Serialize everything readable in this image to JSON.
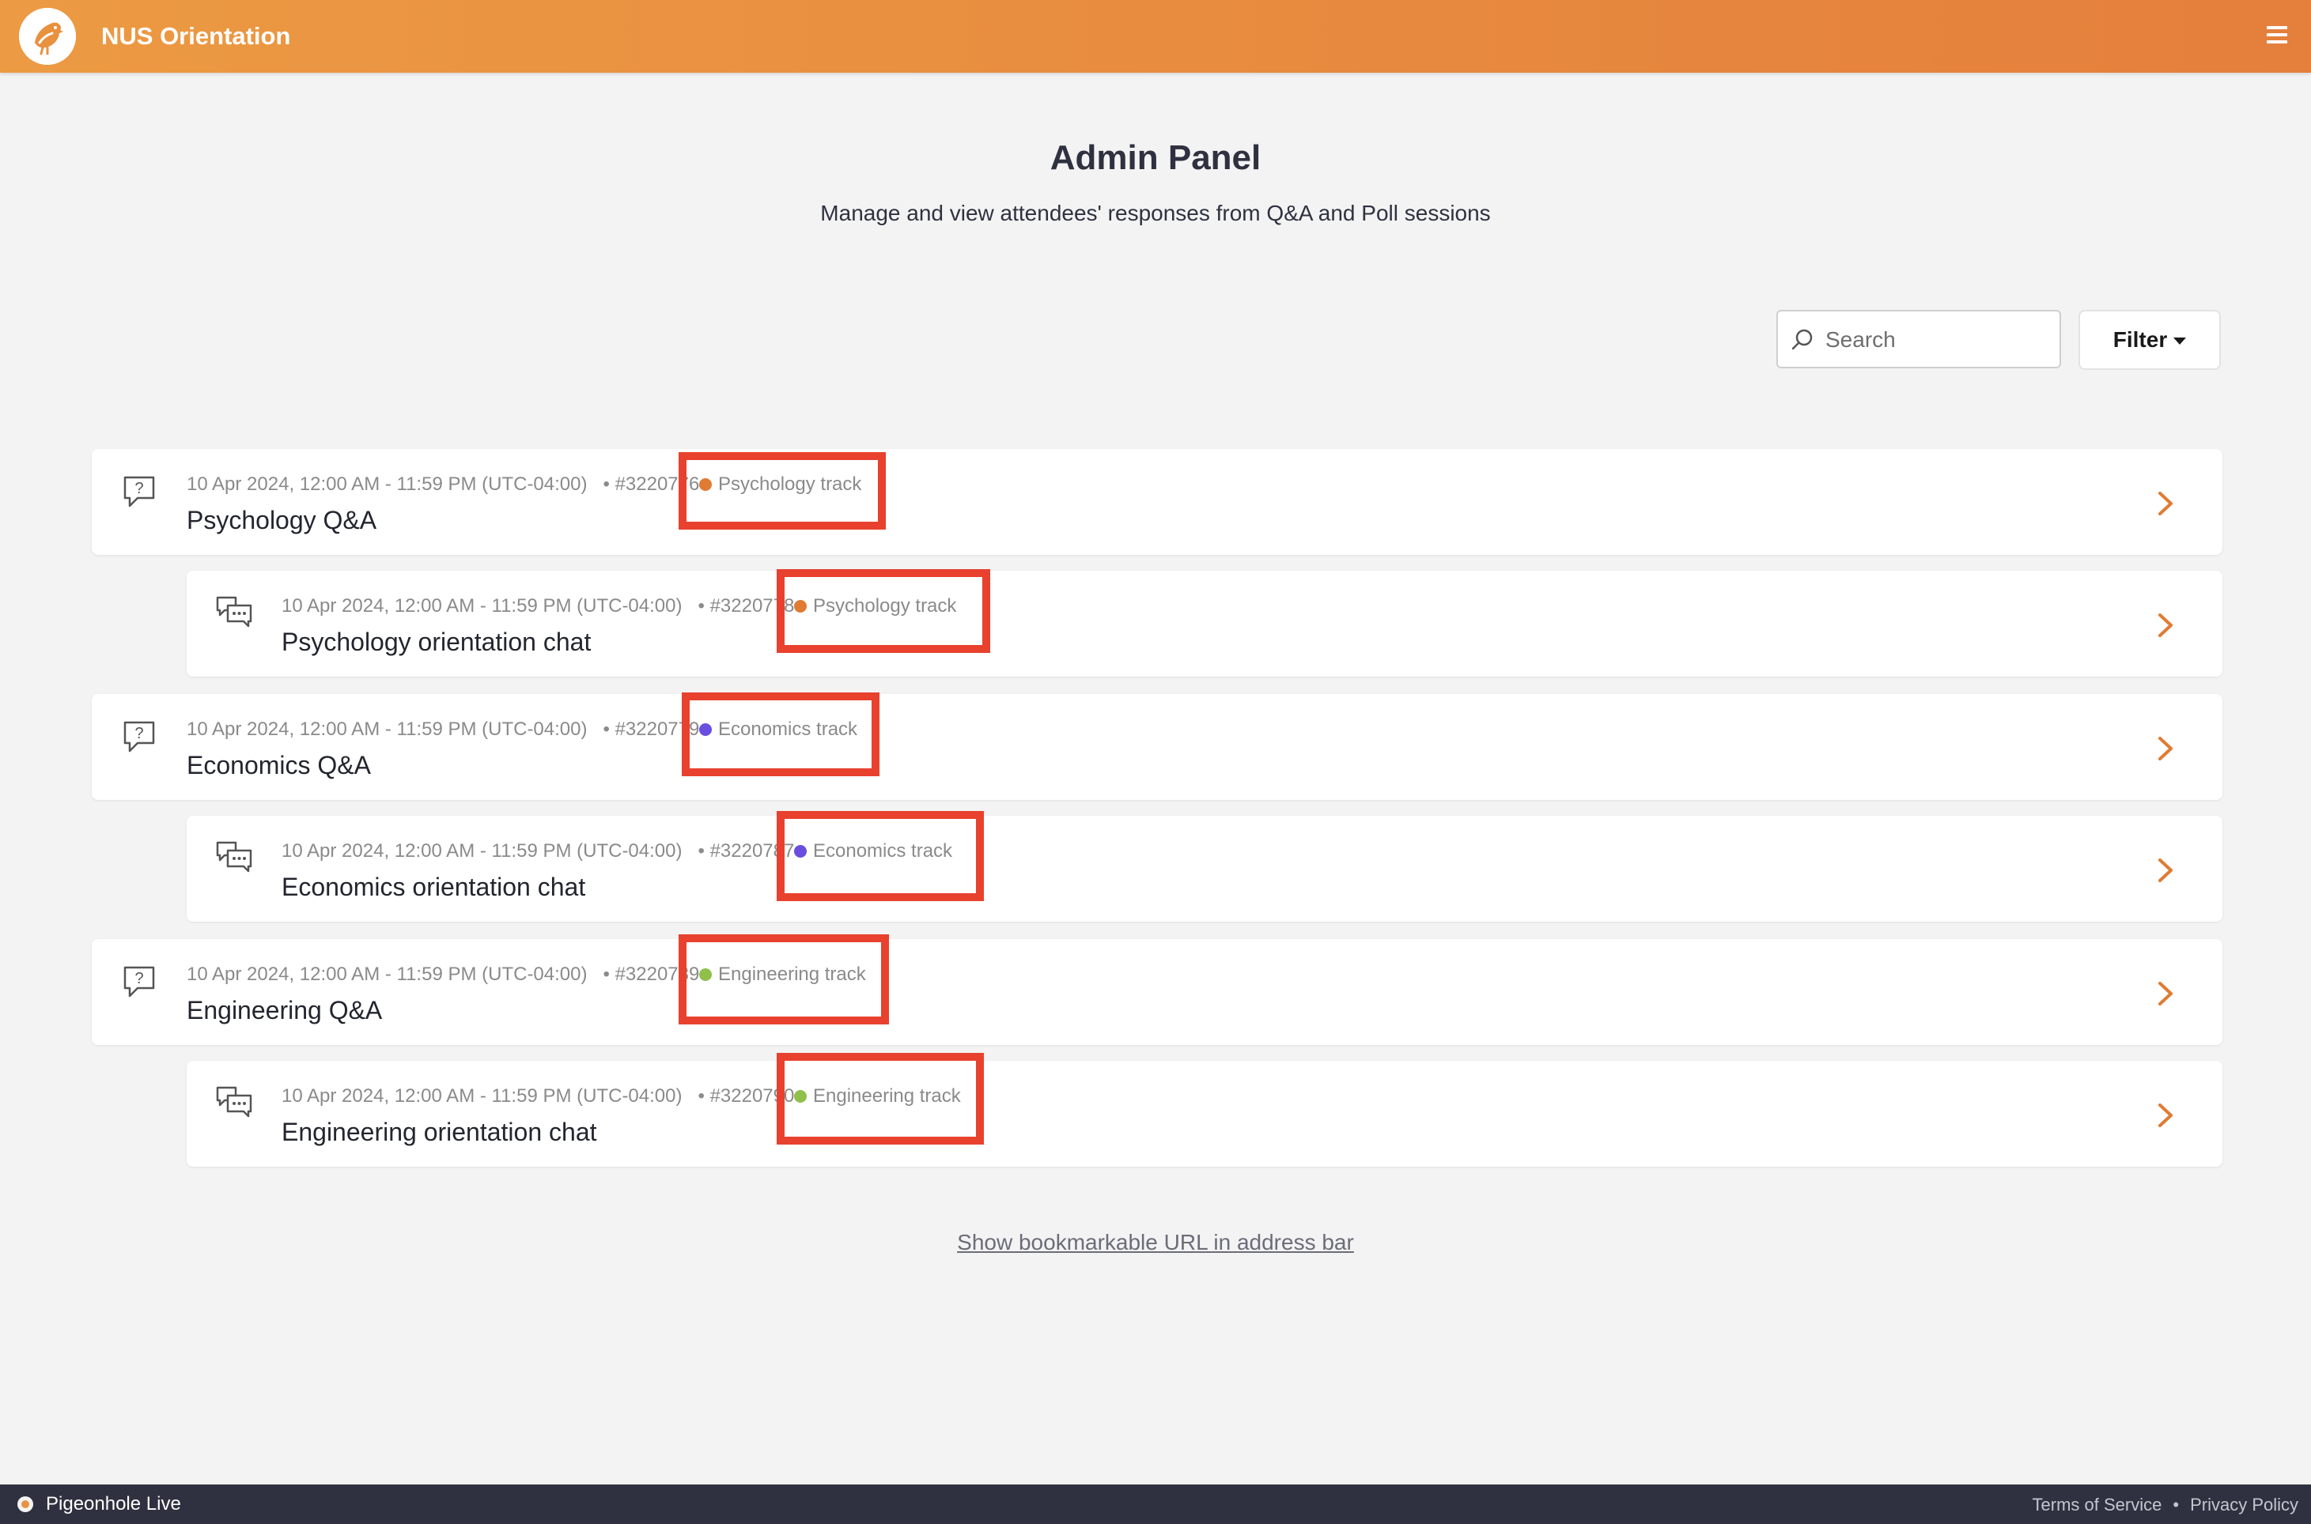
{
  "header": {
    "app_title": "NUS Orientation",
    "logo_icon": "pigeon-logo-icon",
    "menu_icon": "hamburger-menu-icon",
    "brand_gradient": [
      "#ec9a43",
      "#e47f3c"
    ]
  },
  "intro": {
    "title": "Admin Panel",
    "subtitle": "Manage and view attendees' responses from Q&A and Poll sessions"
  },
  "toolbar": {
    "search_placeholder": "Search",
    "filter_label": "Filter"
  },
  "sessions": [
    {
      "type": "qa",
      "icon": "qa-bubble-icon",
      "datetime": "10 Apr 2024, 12:00 AM - 11:59 PM (UTC-04:00)",
      "id": "• #3220776",
      "track": "Psychology track",
      "track_color": "#e07b33",
      "name": "Psychology Q&A"
    },
    {
      "type": "chat",
      "icon": "chat-bubbles-icon",
      "datetime": "10 Apr 2024, 12:00 AM - 11:59 PM (UTC-04:00)",
      "id": "• #3220778",
      "track": "Psychology track",
      "track_color": "#e07b33",
      "name": "Psychology orientation chat"
    },
    {
      "type": "qa",
      "icon": "qa-bubble-icon",
      "datetime": "10 Apr 2024, 12:00 AM - 11:59 PM (UTC-04:00)",
      "id": "• #3220779",
      "track": "Economics track",
      "track_color": "#6a4ee0",
      "name": "Economics Q&A"
    },
    {
      "type": "chat",
      "icon": "chat-bubbles-icon",
      "datetime": "10 Apr 2024, 12:00 AM - 11:59 PM (UTC-04:00)",
      "id": "• #3220787",
      "track": "Economics track",
      "track_color": "#6a4ee0",
      "name": "Economics orientation chat"
    },
    {
      "type": "qa",
      "icon": "qa-bubble-icon",
      "datetime": "10 Apr 2024, 12:00 AM - 11:59 PM (UTC-04:00)",
      "id": "• #3220789",
      "track": "Engineering track",
      "track_color": "#8fc04a",
      "name": "Engineering Q&A"
    },
    {
      "type": "chat",
      "icon": "chat-bubbles-icon",
      "datetime": "10 Apr 2024, 12:00 AM - 11:59 PM (UTC-04:00)",
      "id": "• #3220790",
      "track": "Engineering track",
      "track_color": "#8fc04a",
      "name": "Engineering orientation chat"
    }
  ],
  "highlight_color": "#e8412e",
  "bookmark_link": "Show bookmarkable URL in address bar",
  "footer": {
    "brand": "Pigeonhole Live",
    "terms": "Terms of Service",
    "separator": "•",
    "privacy": "Privacy Policy"
  }
}
